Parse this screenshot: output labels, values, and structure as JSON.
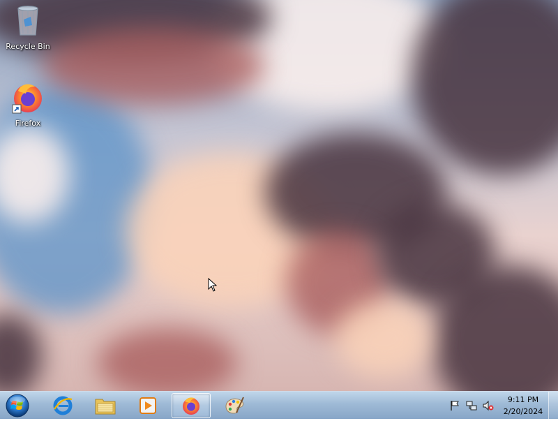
{
  "desktop": {
    "icons": [
      {
        "name": "recycle-bin",
        "label": "Recycle Bin",
        "icon": "recycle-bin-icon"
      },
      {
        "name": "firefox",
        "label": "Firefox",
        "icon": "firefox-icon"
      }
    ]
  },
  "taskbar": {
    "start": {
      "icon": "windows-logo-icon"
    },
    "pinned": [
      {
        "name": "internet-explorer",
        "icon": "internet-explorer-icon",
        "active": false
      },
      {
        "name": "windows-explorer",
        "icon": "folder-icon",
        "active": false
      },
      {
        "name": "media-player",
        "icon": "media-player-icon",
        "active": false
      },
      {
        "name": "firefox",
        "icon": "firefox-icon",
        "active": true
      },
      {
        "name": "paint",
        "icon": "paint-palette-icon",
        "active": false
      }
    ],
    "tray": {
      "icons": [
        "action-center-flag-icon",
        "network-icon",
        "volume-muted-icon"
      ],
      "time": "9:11 PM",
      "date": "2/20/2024"
    }
  },
  "colors": {
    "taskbar": "#9fbcd9",
    "label_text": "#ffffff"
  }
}
